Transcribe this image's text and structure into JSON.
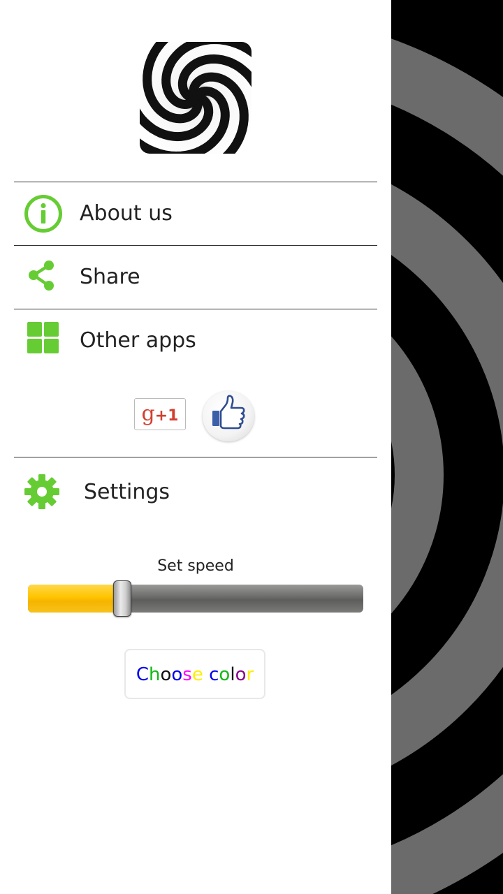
{
  "menu": {
    "about_label": "About us",
    "share_label": "Share",
    "other_apps_label": "Other apps"
  },
  "social": {
    "gplus_g": "g",
    "gplus_plus": "+1"
  },
  "settings": {
    "title": "Settings",
    "speed_label": "Set speed",
    "speed_level": 0.26,
    "choose_color_chars": [
      "C",
      "h",
      "o",
      "o",
      "s",
      "e",
      " ",
      "c",
      "o",
      "l",
      "o",
      "r"
    ],
    "choose_color_colors": [
      "#0000ee",
      "#11bb11",
      "#111111",
      "#0000ee",
      "#ff00ff",
      "#ffee00",
      "#ffffff",
      "#0000ee",
      "#11bb11",
      "#111111",
      "#8b008b",
      "#ffee00"
    ]
  },
  "colors": {
    "icon_green": "#66cc33",
    "slider_fill": "#ffc400",
    "background_light": "#6b6b6b",
    "background_dark": "#000000"
  },
  "icons": {
    "about": "info-circle-icon",
    "share": "share-icon",
    "other_apps": "grid-icon",
    "settings": "gear-icon",
    "like": "thumbs-up-icon"
  }
}
